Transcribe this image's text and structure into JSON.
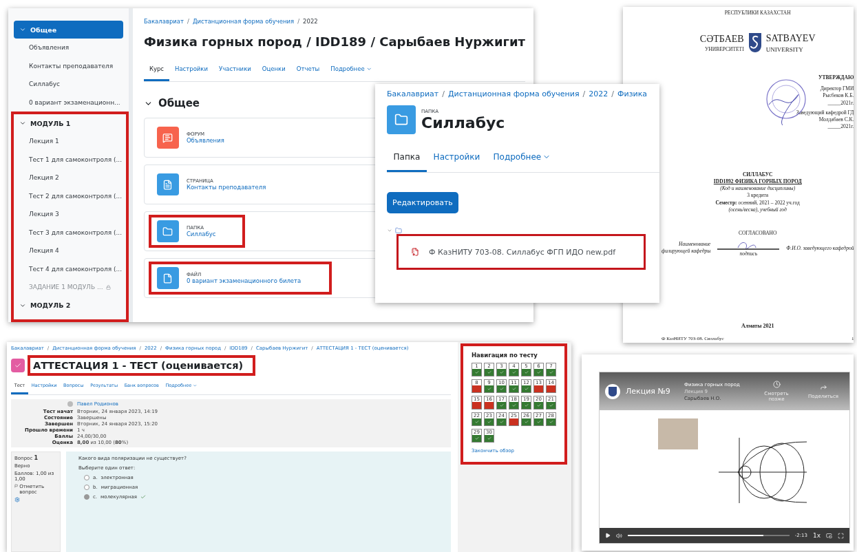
{
  "course_page": {
    "sidebar": {
      "sections": [
        {
          "title": "Общее",
          "selected": true,
          "expanded": true,
          "highlighted": false,
          "items": [
            {
              "label": "Объявления",
              "locked": false
            },
            {
              "label": "Контакты преподавателя",
              "locked": false
            },
            {
              "label": "Силлабус",
              "locked": false
            },
            {
              "label": "0 вариант экзаменационн...",
              "locked": false
            }
          ]
        },
        {
          "title": "МОДУЛЬ 1",
          "selected": false,
          "expanded": true,
          "highlighted": true,
          "items": [
            {
              "label": "Лекция 1",
              "locked": false
            },
            {
              "label": "Тест 1 для самоконтроля (...",
              "locked": false
            },
            {
              "label": "Лекция 2",
              "locked": false
            },
            {
              "label": "Тест 2 для самоконтроля (...",
              "locked": false
            },
            {
              "label": "Лекция 3",
              "locked": false
            },
            {
              "label": "Тест 3 для самоконтроля (...",
              "locked": false
            },
            {
              "label": "Лекция 4",
              "locked": false
            },
            {
              "label": "Тест 4 для самоконтроля (...",
              "locked": false
            },
            {
              "label": "ЗАДАНИЕ 1 МОДУЛЬ ...",
              "locked": true
            }
          ]
        },
        {
          "title": "МОДУЛЬ 2",
          "selected": false,
          "expanded": true,
          "highlighted": true
        }
      ]
    },
    "breadcrumb": {
      "separator": "/",
      "items": [
        "Бакалавриат",
        "Дистанционная форма обучения",
        "2022"
      ]
    },
    "title": "Физика горных пород / IDD189 / Сарыбаев Нуржигит",
    "tabs": [
      {
        "label": "Курс",
        "selected": true,
        "dropdown": false
      },
      {
        "label": "Настройки",
        "selected": false,
        "dropdown": false
      },
      {
        "label": "Участники",
        "selected": false,
        "dropdown": false
      },
      {
        "label": "Оценки",
        "selected": false,
        "dropdown": false
      },
      {
        "label": "Отчеты",
        "selected": false,
        "dropdown": false
      },
      {
        "label": "Подробнее",
        "selected": false,
        "dropdown": true
      }
    ],
    "section_title": "Общее",
    "activities": [
      {
        "kind": "forum",
        "type_label": "ФОРУМ",
        "title": "Объявления",
        "highlighted": false
      },
      {
        "kind": "page",
        "type_label": "СТРАНИЦА",
        "title": "Контакты преподавателя",
        "highlighted": false
      },
      {
        "kind": "folder",
        "type_label": "ПАПКА",
        "title": "Силлабус",
        "highlighted": true
      },
      {
        "kind": "file",
        "type_label": "ФАЙЛ",
        "title": "0 вариант экзаменационного билета",
        "highlighted": true
      }
    ]
  },
  "document": {
    "header": "РЕСПУБЛИКИ КАЗАХСТАН",
    "logo_left": "СӘТБАЕВ",
    "logo_left_sub": "УНИВЕРСИТЕТІ",
    "logo_right": "SATBAYEV",
    "logo_right_sub": "UNIVERSITY",
    "approval": [
      "УТВЕРЖДАЮ",
      "Директор ГМИ",
      "Рысбеков К.Б.",
      "_____2021г.",
      "Заведующий кафедрой ГД",
      "Молдабаев С.К.",
      "_____2021г."
    ],
    "center_lines": [
      {
        "text": "СИЛЛАБУС",
        "kind": "bold"
      },
      {
        "text": "IDD1892 ФИЗИКА ГОРНЫХ ПОРОД",
        "kind": "underline"
      },
      {
        "text": "(Код и наименование дисциплины)",
        "kind": "italic"
      },
      {
        "text": "3 кредита",
        "kind": "plain"
      },
      {
        "text": "**Семестр:** осенний, 2021 – 2022 уч.год",
        "kind": "plain"
      },
      {
        "text": "(осень/весна), учебный год",
        "kind": "italic"
      }
    ],
    "agreed": "СОГЛАСОВАНО",
    "sign_left": [
      "Наименование",
      "филирующей кафедры"
    ],
    "sign_caption": "подпись",
    "sign_right": "Ф.И.О. заведующего кафедрой",
    "city": "Алматы 2021",
    "footer": "Ф КазНИТУ 703-08. Силлабус",
    "page": "1"
  },
  "folder_page": {
    "breadcrumb": {
      "separator": "/",
      "items": [
        "Бакалавриат",
        "Дистанционная форма обучения",
        "2022",
        "Физика"
      ]
    },
    "type_label": "ПАПКА",
    "title": "Силлабус",
    "tabs": [
      {
        "label": "Папка",
        "selected": true,
        "dropdown": false
      },
      {
        "label": "Настройки",
        "selected": false,
        "dropdown": false
      },
      {
        "label": "Подробнее",
        "selected": false,
        "dropdown": true
      }
    ],
    "edit_button": "Редактировать",
    "file": {
      "name": "Ф КазНИТУ 703-08. Силлабус ФГП ИДО new.pdf",
      "highlighted": true
    }
  },
  "quiz_page": {
    "breadcrumb": {
      "separator": "/",
      "items": [
        "Бакалавриат",
        "Дистанционная форма обучения",
        "2022",
        "Физика горных пород",
        "IDD189",
        "Сарыбаев Нуржигит",
        "АТТЕСТАЦИЯ 1 - ТЕСТ (оценивается)"
      ]
    },
    "title": "АТТЕСТАЦИЯ 1 - ТЕСТ (оценивается)",
    "title_highlighted": true,
    "tabs": [
      {
        "label": "Тест",
        "selected": true,
        "dropdown": false
      },
      {
        "label": "Настройки",
        "selected": false,
        "dropdown": false
      },
      {
        "label": "Вопросы",
        "selected": false,
        "dropdown": false
      },
      {
        "label": "Результаты",
        "selected": false,
        "dropdown": false
      },
      {
        "label": "Банк вопросов",
        "selected": false,
        "dropdown": false
      },
      {
        "label": "Подробнее",
        "selected": false,
        "dropdown": true
      }
    ],
    "user": "Павел Родионов",
    "summary": [
      {
        "label": "Тест начат",
        "value": "Вторник, 24 января 2023, 14:19"
      },
      {
        "label": "Состояние",
        "value": "Завершены"
      },
      {
        "label": "Завершен",
        "value": "Вторник, 24 января 2023, 15:20"
      },
      {
        "label": "Прошло времени",
        "value": "1 ч"
      },
      {
        "label": "Баллы",
        "value": "24,00/30,00"
      },
      {
        "label": "Оценка",
        "value": "**8,00** из 10,00 (**80**%)"
      }
    ],
    "question": {
      "number_label": "Вопрос",
      "number": "1",
      "status": "Верно",
      "score": "Баллов: 1,00 из 1,00",
      "flag": "Отметить вопрос",
      "text": "Какого вида поляризации не существует?",
      "prompt": "Выберите один ответ:",
      "options": [
        {
          "letter": "a.",
          "text": "электронная",
          "selected": false,
          "correct": false
        },
        {
          "letter": "b.",
          "text": "миграционная",
          "selected": false,
          "correct": false
        },
        {
          "letter": "c.",
          "text": "молекулярная",
          "selected": true,
          "correct": true
        }
      ]
    },
    "navigation": {
      "title": "Навигация по тесту",
      "highlighted": true,
      "finish_link": "Закончить обзор",
      "questions": [
        {
          "number": "1",
          "correct": true
        },
        {
          "number": "2",
          "correct": true
        },
        {
          "number": "3",
          "correct": true
        },
        {
          "number": "4",
          "correct": true
        },
        {
          "number": "5",
          "correct": true
        },
        {
          "number": "6",
          "correct": true
        },
        {
          "number": "7",
          "correct": true
        },
        {
          "number": "8",
          "correct": false
        },
        {
          "number": "9",
          "correct": true
        },
        {
          "number": "10",
          "correct": true
        },
        {
          "number": "11",
          "correct": true
        },
        {
          "number": "12",
          "correct": true
        },
        {
          "number": "13",
          "correct": false
        },
        {
          "number": "14",
          "correct": false
        },
        {
          "number": "15",
          "correct": false
        },
        {
          "number": "16",
          "correct": false
        },
        {
          "number": "17",
          "correct": true
        },
        {
          "number": "18",
          "correct": true
        },
        {
          "number": "19",
          "correct": true
        },
        {
          "number": "20",
          "correct": true
        },
        {
          "number": "21",
          "correct": true
        },
        {
          "number": "22",
          "correct": true
        },
        {
          "number": "23",
          "correct": true
        },
        {
          "number": "24",
          "correct": true
        },
        {
          "number": "25",
          "correct": false
        },
        {
          "number": "26",
          "correct": true
        },
        {
          "number": "27",
          "correct": true
        },
        {
          "number": "28",
          "correct": true
        },
        {
          "number": "29",
          "correct": true
        },
        {
          "number": "30",
          "correct": true
        }
      ]
    }
  },
  "video": {
    "channel_title": "Лекция №9",
    "title": "Физика горных пород",
    "subtitle": "Лекция 9",
    "author": "Сарыбаев Н.О.",
    "actions": [
      {
        "kind": "clock",
        "label": "Смотреть позже"
      },
      {
        "kind": "share",
        "label": "Поделиться"
      }
    ],
    "time": "-2:13",
    "speed": "1x",
    "level": 0.84
  }
}
